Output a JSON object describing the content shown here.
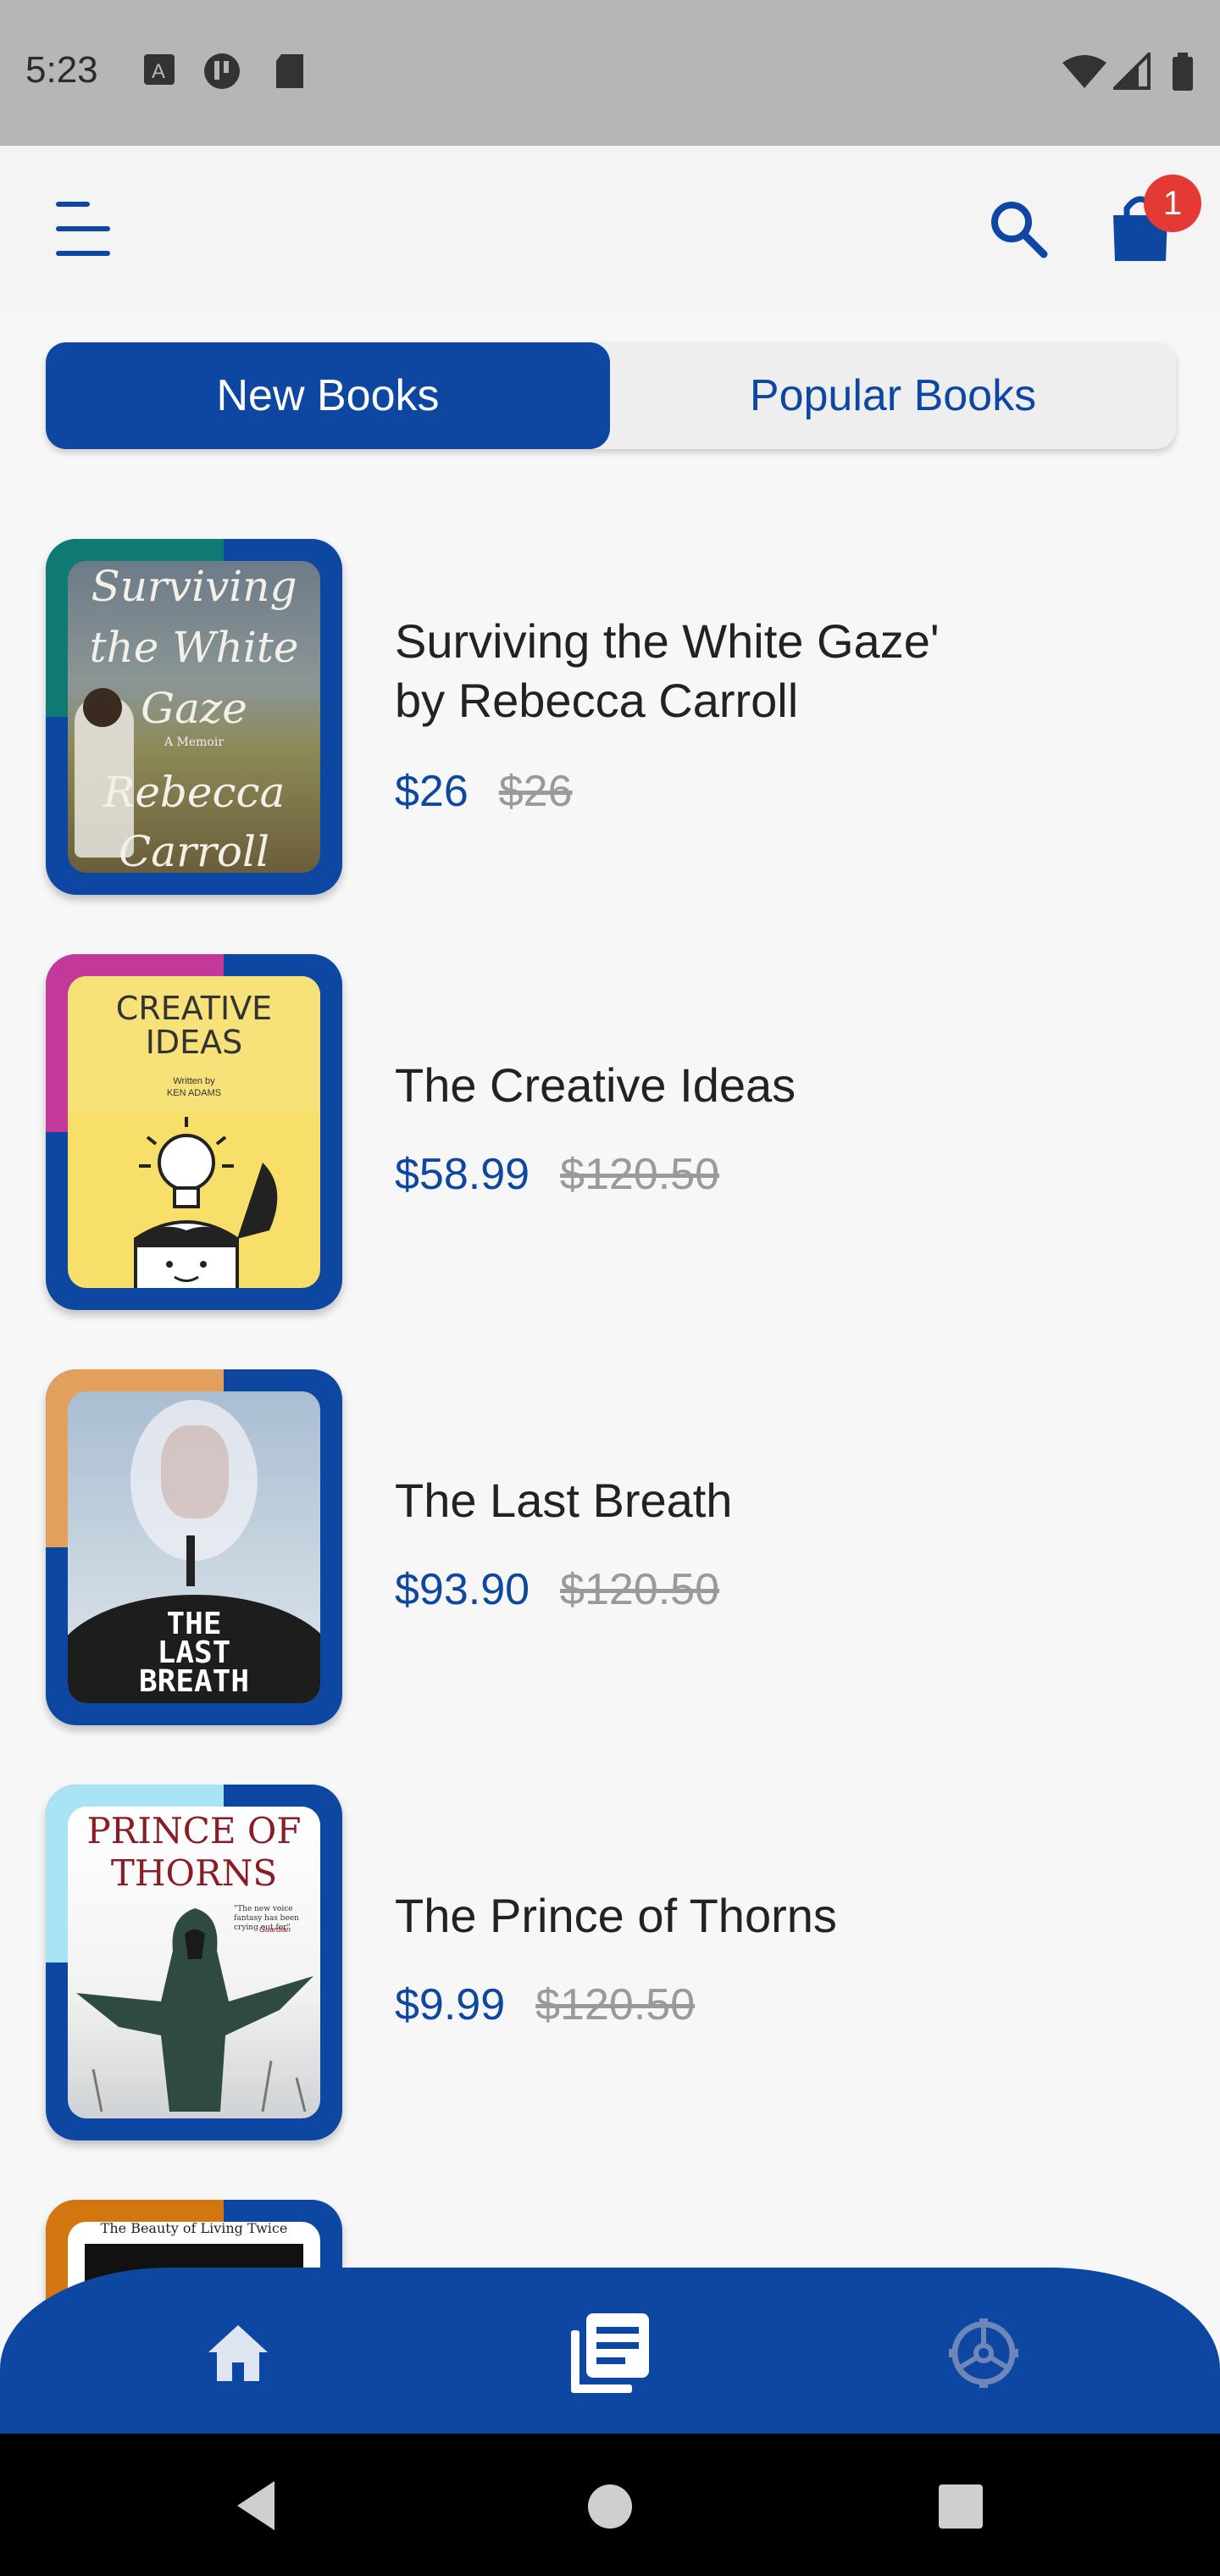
{
  "status_bar": {
    "time": "5:23"
  },
  "header": {
    "menu_icon": "menu-icon",
    "search_icon": "search-icon",
    "cart_icon": "shopping-bag-icon",
    "cart_count": "1"
  },
  "tabs": [
    {
      "label": "New Books",
      "selected": true
    },
    {
      "label": "Popular Books",
      "selected": false
    }
  ],
  "books": [
    {
      "title_line1": "Surviving the White Gaze'",
      "title_line2": "by Rebecca Carroll",
      "price": "$26",
      "old_price": "$26",
      "cover_text_1": "Surviving",
      "cover_text_2": "the White",
      "cover_text_3": "Gaze",
      "cover_text_4": "A Memoir",
      "cover_text_5": "Rebecca",
      "cover_text_6": "Carroll"
    },
    {
      "title": "The Creative Ideas",
      "price": "$58.99",
      "old_price": "$120.50",
      "cover_text_1": "CREATIVE",
      "cover_text_2": "IDEAS",
      "cover_text_3": "Written by",
      "cover_text_4": "KEN ADAMS"
    },
    {
      "title": "The Last Breath",
      "price": "$93.90",
      "old_price": "$120.50",
      "cover_text_1": "THE",
      "cover_text_2": "LAST",
      "cover_text_3": "BREATH"
    },
    {
      "title": "The Prince of Thorns",
      "price": "$9.99",
      "old_price": "$120.50",
      "cover_text_1": "PRINCE OF",
      "cover_text_2": "THORNS",
      "cover_text_3": "\"The new voice fantasy has been crying out for\"",
      "cover_text_4": "Guardian"
    },
    {
      "cover_text_1": "The Beauty of Living Twice"
    }
  ],
  "bottom_nav": [
    {
      "icon": "home-icon"
    },
    {
      "icon": "library-icon",
      "active": true
    },
    {
      "icon": "settings-icon"
    }
  ],
  "colors": {
    "primary": "#0d47a1",
    "badge": "#e53935",
    "strike": "#9a9a9a"
  }
}
